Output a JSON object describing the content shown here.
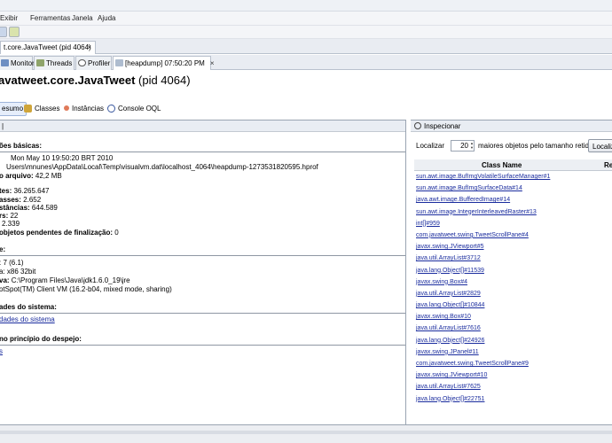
{
  "menu": [
    "Exibir",
    "Ferramentas",
    "Janela",
    "Ajuda"
  ],
  "document_tab": {
    "title": "t.core.JavaTweet (pid 4064)",
    "close": "×"
  },
  "sub_tabs": [
    {
      "label": "Monitor"
    },
    {
      "label": "Threads"
    },
    {
      "label": "Profiler"
    },
    {
      "label": "[heapdump] 07:50:20 PM",
      "close": "×"
    }
  ],
  "page_title": {
    "bold": "avatweet.core.JavaTweet",
    "normal": " (pid 4064)"
  },
  "view_tabs": [
    "esumo",
    "Classes",
    "Instâncias",
    "Console OQL"
  ],
  "summary": {
    "basic_title": "ões básicas:",
    "date_line": "Mon May 10 19:50:20 BRT 2010",
    "path_line": "Users\\mnunes\\AppData\\Local\\Temp\\visualvm.dat\\localhost_4064\\heapdump-1273531820595.hprof",
    "file_size_label": "o arquivo:",
    "file_size_value": "42,2 MB",
    "bytes_label": "tes:",
    "bytes_value": "36.265.647",
    "classes_label": "asses:",
    "classes_value": "2.652",
    "instances_label": "stâncias:",
    "instances_value": "644.589",
    "classloaders_label": "rs:",
    "classloaders_value": "22",
    "gc_roots_value": "2.339",
    "finalization_label": "objetos pendentes de finalização:",
    "finalization_value": "0",
    "env_title": "e:",
    "os_line": ": 7 (6.1)",
    "arch_line": "a: x86 32bit",
    "java_home_label": "va:",
    "java_home_value": "C:\\Program Files\\Java\\jdk1.6.0_19\\jre",
    "jvm_line": "otSpot(TM) Client VM (16.2-b04, mixed mode, sharing)",
    "sysprops_title": "ades do sistema:",
    "sysprops_link": "dades do sistema",
    "threads_title": "no princípio do despejo:",
    "threads_link": "s"
  },
  "inspect": {
    "title": "Inspecionar",
    "locate_label": "Localizar",
    "count": "20",
    "retained_label": "maiores objetos pelo tamanho retido:",
    "button": "Localiza",
    "col_class": "Class Name",
    "col_retained": "Re",
    "rows": [
      "sun.awt.image.BufImgVolatileSurfaceManager#1",
      "sun.awt.image.BufImgSurfaceData#14",
      "java.awt.image.BufferedImage#14",
      "sun.awt.image.IntegerInterleavedRaster#13",
      "int[]#959",
      "com.javatweet.swing.TweetScrollPane#4",
      "javax.swing.JViewport#5",
      "java.util.ArrayList#3712",
      "java.lang.Object[]#11539",
      "javax.swing.Box#4",
      "java.util.ArrayList#2829",
      "java.lang.Object[]#10844",
      "javax.swing.Box#10",
      "java.util.ArrayList#7616",
      "java.lang.Object[]#24926",
      "javax.swing.JPanel#11",
      "com.javatweet.swing.TweetScrollPane#9",
      "javax.swing.JViewport#10",
      "java.util.ArrayList#7625",
      "java.lang.Object[]#22751"
    ]
  }
}
